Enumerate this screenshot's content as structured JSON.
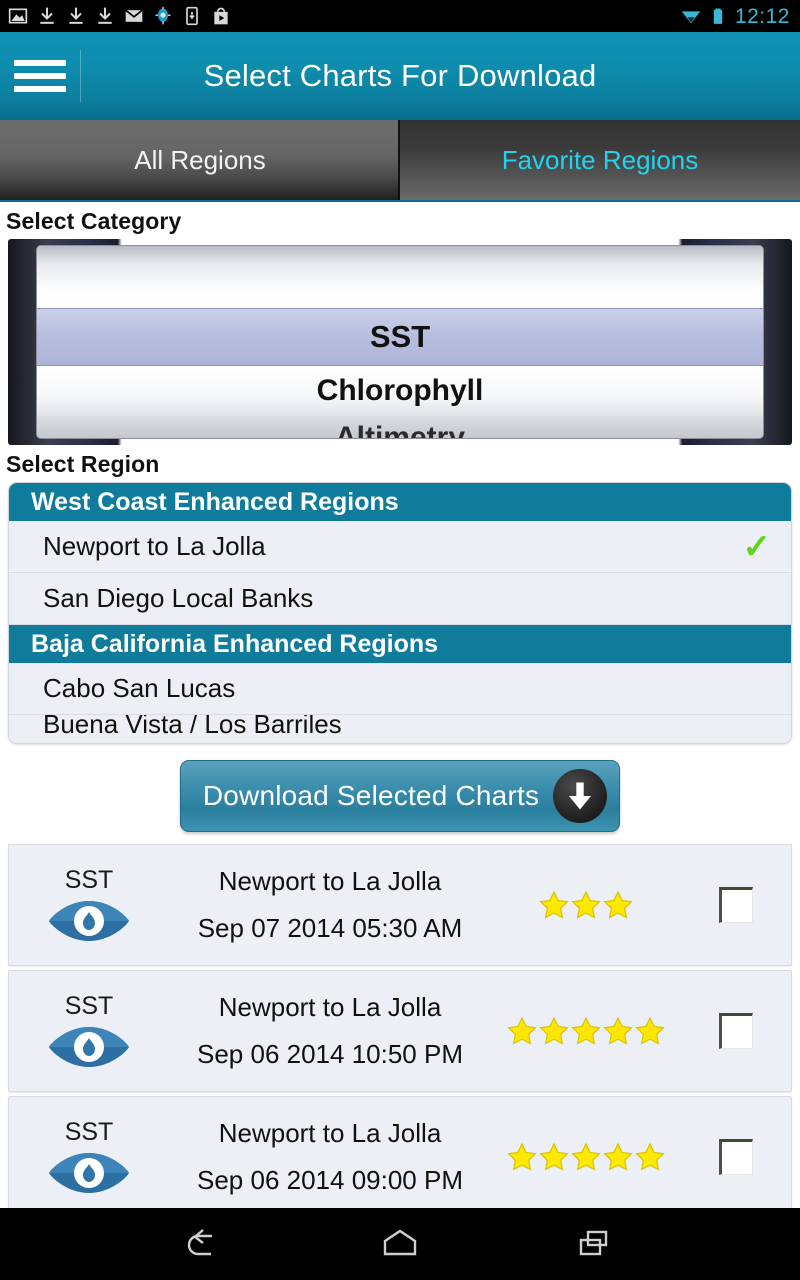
{
  "status_bar": {
    "time": "12:12",
    "left_icons": [
      "image-icon",
      "download-icon",
      "download-icon",
      "download-icon",
      "mail-icon",
      "gps-icon",
      "device-download-icon",
      "play-store-icon"
    ],
    "right_icons": [
      "wifi-icon",
      "battery-icon"
    ],
    "accent_color": "#39b7d8"
  },
  "action_bar": {
    "menu_icon": "hamburger-icon",
    "title": "Select Charts For Download",
    "background_color": "#0e8cae"
  },
  "tabs": [
    {
      "label": "All Regions",
      "selected": false
    },
    {
      "label": "Favorite Regions",
      "selected": true,
      "color": "#22d3ee"
    }
  ],
  "category_section": {
    "label": "Select Category",
    "options": [
      "SST",
      "Chlorophyll",
      "Altimetry"
    ],
    "selected": "SST",
    "visible_below_selected": "Chlorophyll",
    "partially_visible": "Altimetry"
  },
  "region_section": {
    "label": "Select Region",
    "groups": [
      {
        "header": "West Coast Enhanced Regions",
        "items": [
          {
            "name": "Newport to La Jolla",
            "selected": true,
            "check_icon": "green-check-icon"
          },
          {
            "name": "San Diego Local Banks",
            "selected": false
          }
        ]
      },
      {
        "header": "Baja California Enhanced Regions",
        "items": [
          {
            "name": "Cabo San Lucas",
            "selected": false
          },
          {
            "name": "Buena Vista / Los Barriles",
            "selected": false,
            "clipped": true
          }
        ]
      }
    ],
    "header_color": "#0f7c9b",
    "check_color": "#5fd41c"
  },
  "download_button": {
    "label": "Download Selected Charts",
    "icon": "download-arrow-icon"
  },
  "chart_list": [
    {
      "type": "SST",
      "icon": "eye-icon",
      "region": "Newport to La Jolla",
      "date": "Sep 07 2014 05:30 AM",
      "stars": 3,
      "checked": false
    },
    {
      "type": "SST",
      "icon": "eye-icon",
      "region": "Newport to La Jolla",
      "date": "Sep 06 2014 10:50 PM",
      "stars": 5,
      "checked": false
    },
    {
      "type": "SST",
      "icon": "eye-icon",
      "region": "Newport to La Jolla",
      "date": "Sep 06 2014 09:00 PM",
      "stars": 5,
      "checked": false
    }
  ],
  "nav_bar": {
    "buttons": [
      "back-icon",
      "home-icon",
      "recents-icon"
    ]
  }
}
